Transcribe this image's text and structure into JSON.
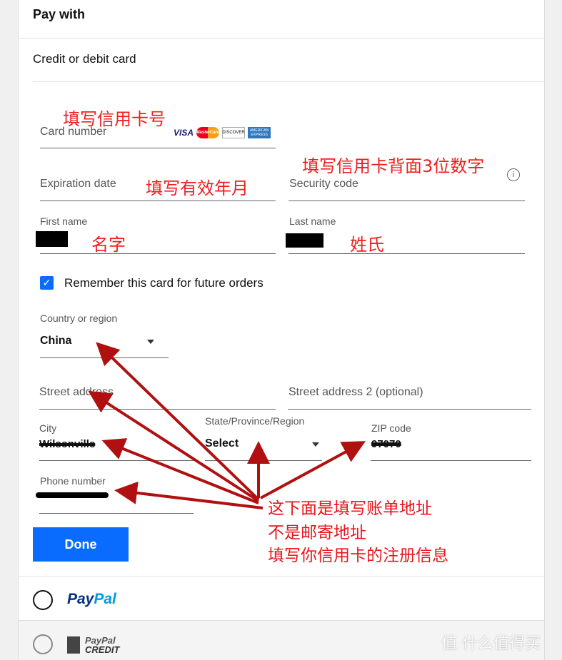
{
  "header": {
    "title": "Pay with"
  },
  "method": {
    "label": "Credit or debit card"
  },
  "card_logos": [
    "VISA",
    "MasterCard",
    "DISCOVER",
    "AMERICAN EXPRESS"
  ],
  "fields": {
    "card_number": "Card number",
    "expiration": "Expiration date",
    "security": "Security code",
    "first_name": "First name",
    "last_name": "Last name",
    "remember": "Remember this card for future orders",
    "country_label": "Country or region",
    "country_value": "China",
    "street": "Street address",
    "street2": "Street address 2 (optional)",
    "city_label": "City",
    "city_value": "Wilsonville",
    "state_label": "State/Province/Region",
    "state_value": "Select",
    "zip_label": "ZIP code",
    "zip_value": "97070",
    "phone_label": "Phone number"
  },
  "done_label": "Done",
  "paypal": {
    "pay": "Pay",
    "pal": "Pal"
  },
  "paypal_credit": {
    "line1": "PayPal",
    "line2": "CREDIT"
  },
  "annotations": {
    "card": "填写信用卡号",
    "security": "填写信用卡背面3位数字",
    "expiry": "填写有效年月",
    "first": "名字",
    "last": "姓氏",
    "note1": "这下面是填写账单地址",
    "note2": "不是邮寄地址",
    "note3": "填写你信用卡的注册信息"
  },
  "watermark": "值 什么值得买",
  "colors": {
    "accent": "#0a6cff",
    "annotation": "#f01e1e",
    "arrow": "#b01010"
  }
}
